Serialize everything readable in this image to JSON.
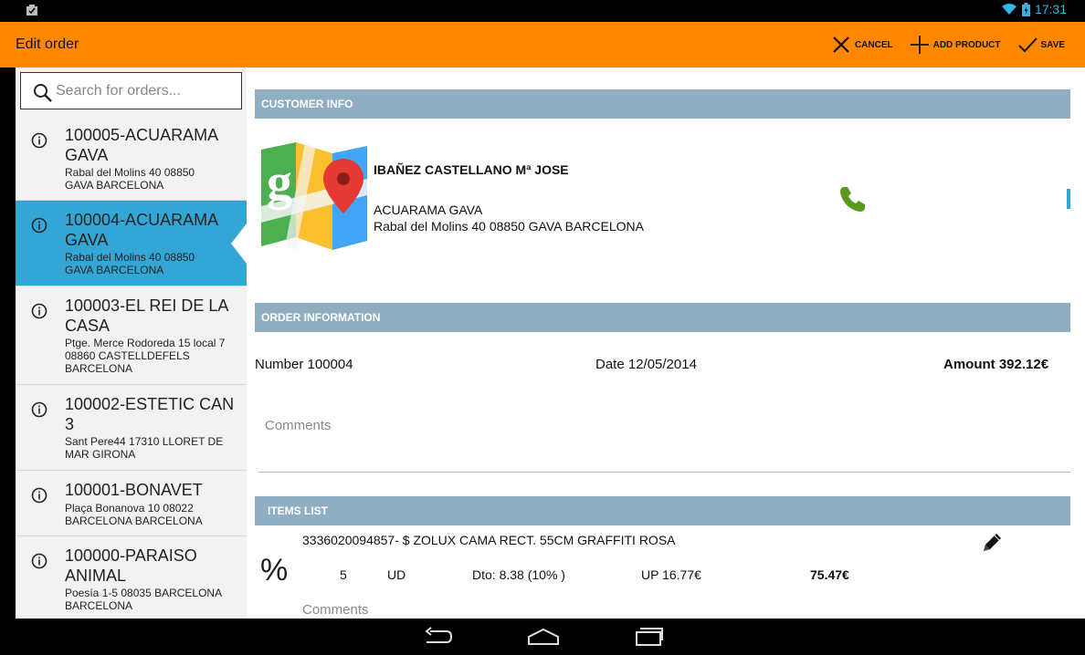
{
  "status_bar": {
    "time": "17:31"
  },
  "action_bar": {
    "title": "Edit order",
    "cancel_label": "CANCEL",
    "add_product_label": "ADD PRODUCT",
    "save_label": "SAVE"
  },
  "search": {
    "placeholder": "Search for orders..."
  },
  "orders": [
    {
      "title": "100005-ACUARAMA GAVA",
      "address_line1": "Rabal del Molins 40    08850",
      "address_line2": "GAVA  BARCELONA"
    },
    {
      "title": "100004-ACUARAMA GAVA",
      "address_line1": "Rabal del Molins 40    08850",
      "address_line2": "GAVA  BARCELONA"
    },
    {
      "title": "100003-EL REI DE LA CASA",
      "address_line1": "Ptge. Merce Rodoreda 15 local 7",
      "address_line2": "08860 CASTELLDEFELS",
      "address_line3": "BARCELONA"
    },
    {
      "title": "100002-ESTETIC CAN 3",
      "address_line1": "Sant Pere44 17310 LLORET DE",
      "address_line2": "MAR  GIRONA"
    },
    {
      "title": "100001-BONAVET",
      "address_line1": "Plaça Bonanova 10    08022",
      "address_line2": "BARCELONA     BARCELONA"
    },
    {
      "title": "100000-PARAISO ANIMAL",
      "address_line1": "Poesía 1-5   08035 BARCELONA",
      "address_line2": "BARCELONA"
    }
  ],
  "customer_info": {
    "header": "CUSTOMER INFO",
    "name": "IBAÑEZ CASTELLANO Mª JOSE",
    "company": "ACUARAMA GAVA",
    "address": "Rabal del Molins 40 08850 GAVA BARCELONA"
  },
  "order_info": {
    "header": "ORDER INFORMATION",
    "number": "Number 100004",
    "date": "Date 12/05/2014",
    "amount": "Amount 392.12€",
    "comments_placeholder": "Comments"
  },
  "items_list": {
    "header": "ITEMS LIST",
    "items": [
      {
        "code_desc": "3336020094857- $ ZOLUX CAMA RECT. 55CM GRAFFITI ROSA",
        "qty": "5",
        "unit": "UD",
        "discount": "Dto: 8.38 (10% )",
        "unit_price": "UP 16.77€",
        "total": "75.47€",
        "comments": "Comments"
      }
    ]
  },
  "colors": {
    "action_bar": "#ff8800",
    "selected_item": "#33a6d6",
    "section_header": "#8faec2",
    "status_accent": "#33b5e5",
    "phone_green": "#5a9a1a"
  }
}
